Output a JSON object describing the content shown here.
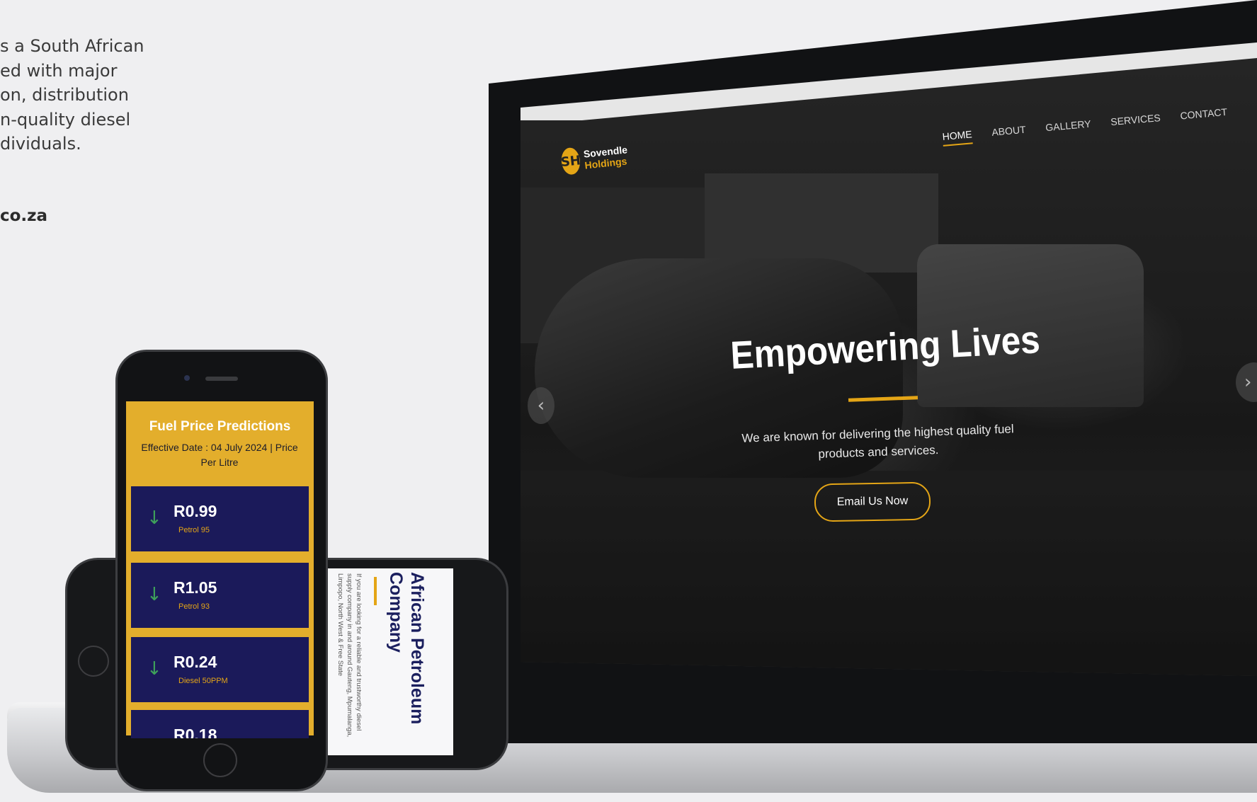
{
  "intro": {
    "lines": [
      "s a South African",
      "ed with major",
      "on, distribution",
      "n-quality diesel",
      "dividuals."
    ],
    "link": "co.za"
  },
  "website": {
    "logo_line1": "Sovendle",
    "logo_line2": "Holdings",
    "logo_mark": "SH",
    "nav": [
      "HOME",
      "ABOUT",
      "GALLERY",
      "SERVICES",
      "CONTACT"
    ],
    "active_nav": "HOME",
    "hero_title": "Empowering Lives",
    "hero_subtitle": "We are known for delivering the highest quality fuel products and services.",
    "cta_label": "Email Us Now",
    "accent_color": "#e4a516"
  },
  "phone_portrait": {
    "title": "Fuel Price Predictions",
    "subtitle": "Effective Date : 04 July 2024 | Price Per Litre",
    "prices": [
      {
        "value": "R0.99",
        "label": "Petrol 95",
        "trend": "down-arrow-icon"
      },
      {
        "value": "R1.05",
        "label": "Petrol 93",
        "trend": "down-arrow-icon"
      },
      {
        "value": "R0.24",
        "label": "Diesel 50PPM",
        "trend": "down-arrow-icon"
      }
    ],
    "partial_price": "R0.18"
  },
  "phone_landscape": {
    "title": "African Petroleum Company",
    "body": "If you are looking for a reliable and trustworthy diesel supply company in and around Gauteng, Mpumalanga, Limpopo, North West & Free State"
  }
}
